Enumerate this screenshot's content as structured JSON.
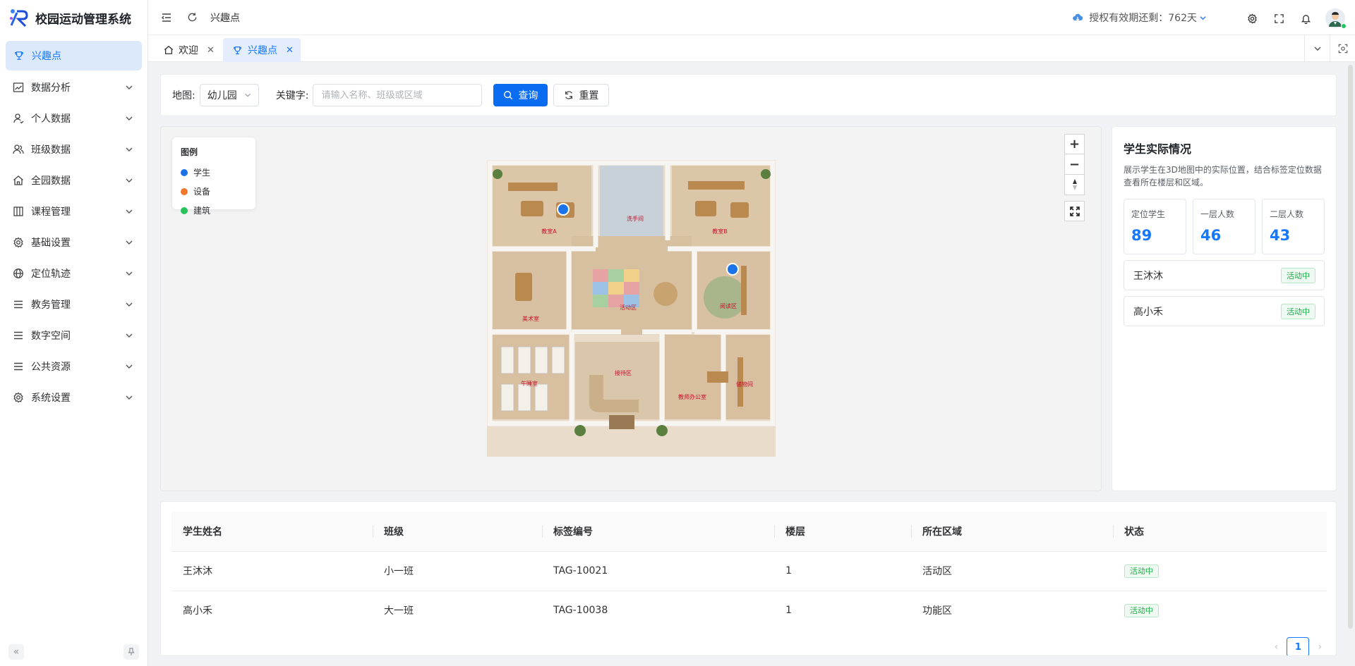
{
  "app": {
    "name": "校园运动管理系统"
  },
  "sidebar": {
    "active": {
      "label": "兴趣点",
      "icon": "trophy-icon"
    },
    "items": [
      {
        "label": "数据分析",
        "icon": "chart-line-icon"
      },
      {
        "label": "个人数据",
        "icon": "user-icon"
      },
      {
        "label": "班级数据",
        "icon": "user-group-icon"
      },
      {
        "label": "全园数据",
        "icon": "home-icon"
      },
      {
        "label": "课程管理",
        "icon": "columns-icon"
      },
      {
        "label": "基础设置",
        "icon": "gear-icon"
      },
      {
        "label": "定位轨迹",
        "icon": "globe-icon"
      },
      {
        "label": "教务管理",
        "icon": "menu-lines-icon"
      },
      {
        "label": "数字空间",
        "icon": "menu-lines-icon"
      },
      {
        "label": "公共资源",
        "icon": "menu-lines-icon"
      },
      {
        "label": "系统设置",
        "icon": "gear-icon"
      }
    ]
  },
  "header": {
    "breadcrumb": "兴趣点",
    "license_text": "授权有效期还剩：762天"
  },
  "tabs": [
    {
      "label": "欢迎",
      "icon": "home-icon"
    },
    {
      "label": "兴趣点",
      "icon": "trophy-icon"
    }
  ],
  "filter": {
    "map_label": "地图:",
    "map_value": "幼儿园",
    "keyword_label": "关键字:",
    "keyword_placeholder": "请输入名称、班级或区域",
    "search_button": "查询",
    "reset_button": "重置"
  },
  "legend": {
    "title": "图例",
    "items": [
      {
        "label": "学生",
        "color": "#1a73e8"
      },
      {
        "label": "设备",
        "color": "#f07a2b"
      },
      {
        "label": "建筑",
        "color": "#27c25a"
      }
    ]
  },
  "floorplan": {
    "rooms": [
      "教室A",
      "洗手间",
      "教室B",
      "美术室",
      "活动区",
      "阅读区",
      "午睡室",
      "接待区",
      "教师办公室",
      "储物间"
    ]
  },
  "info": {
    "title": "学生实际情况",
    "description": "展示学生在3D地图中的实际位置，结合标签定位数据查看所在楼层和区域。",
    "stats": [
      {
        "label": "定位学生",
        "value": "89"
      },
      {
        "label": "一层人数",
        "value": "46"
      },
      {
        "label": "二层人数",
        "value": "43"
      }
    ],
    "students": [
      {
        "name": "王沐沐",
        "status": "活动中"
      },
      {
        "name": "高小禾",
        "status": "活动中"
      }
    ]
  },
  "table": {
    "headers": [
      "学生姓名",
      "班级",
      "标签编号",
      "楼层",
      "所在区域",
      "状态"
    ],
    "rows": [
      [
        "王沐沐",
        "小一班",
        "TAG-10021",
        "1",
        "活动区",
        "活动中"
      ],
      [
        "高小禾",
        "大一班",
        "TAG-10038",
        "1",
        "功能区",
        "活动中"
      ]
    ]
  },
  "pager": {
    "current": "1"
  },
  "colors": {
    "primary": "#1677ff",
    "active_bg": "#dbe9fb",
    "success": "#22a94a"
  }
}
